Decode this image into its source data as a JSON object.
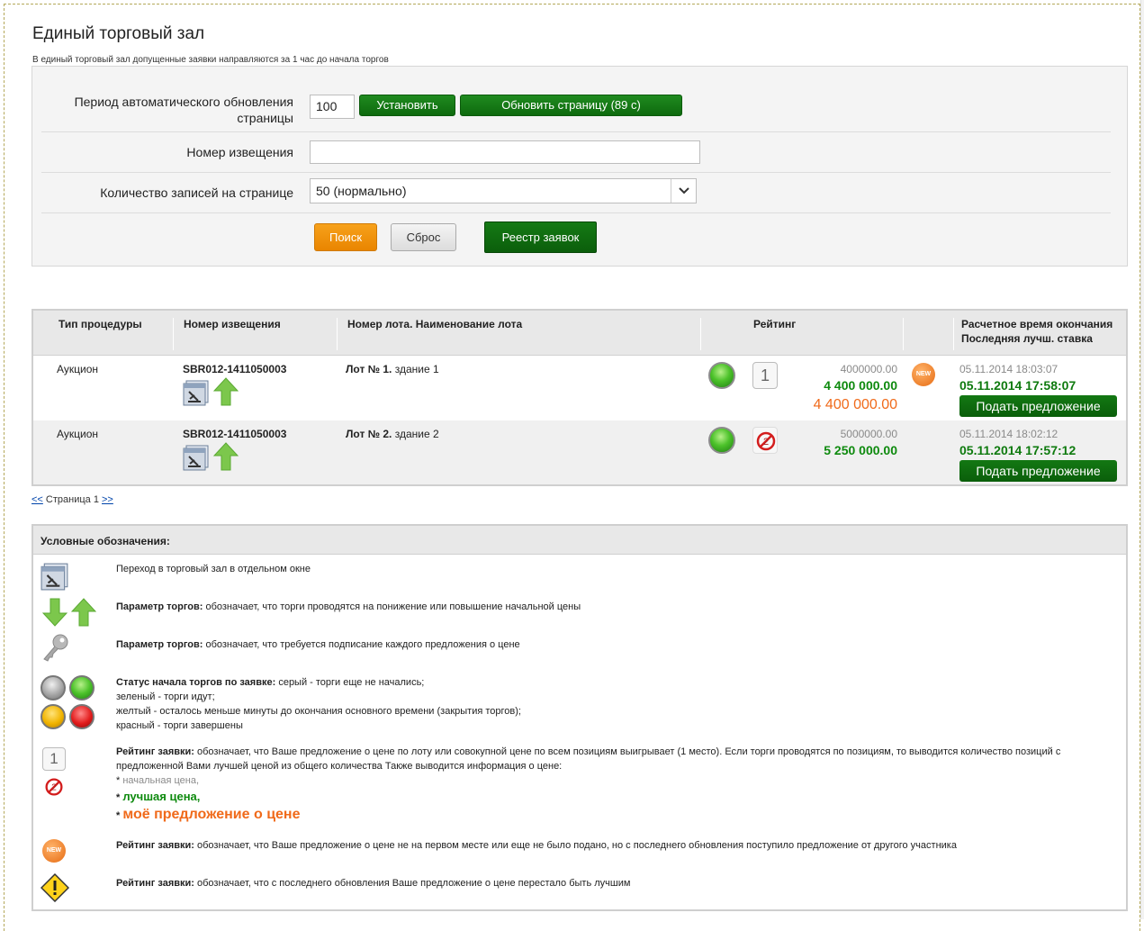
{
  "page": {
    "title": "Единый торговый зал",
    "subtitle": "В единый торговый зал допущенные заявки направляются за 1 час до начала торгов"
  },
  "form": {
    "refresh_label_line1": "Период автоматического обновления",
    "refresh_label_line2": "страницы",
    "refresh_value": "100",
    "set_button": "Установить",
    "refresh_button": "Обновить страницу (89 с)",
    "notice_label": "Номер извещения",
    "notice_value": "",
    "records_label": "Количество записей на странице",
    "records_value": "50 (нормально)",
    "search_button": "Поиск",
    "reset_button": "Сброс",
    "registry_button": "Реестр заявок"
  },
  "table": {
    "headers": {
      "type": "Тип процедуры",
      "notice": "Номер извещения",
      "lot": "Номер лота. Наименование лота",
      "rating": "Рейтинг",
      "end_line1": "Расчетное время окончания",
      "end_line2": "Последняя лучш. ставка"
    },
    "rows": [
      {
        "type": "Аукцион",
        "notice": "SBR012-1411050003",
        "lot_no": "Лот № 1.",
        "lot_name": " здание 1",
        "rank": "1",
        "start_price": "4000000.00",
        "best_price": "4 400 000.00",
        "my_price": "4 400 000.00",
        "badge": "NEW",
        "end_time": "05.11.2014 18:03:07",
        "last_bid_time": "05.11.2014 17:58:07",
        "offer_button": "Подать предложение"
      },
      {
        "type": "Аукцион",
        "notice": "SBR012-1411050003",
        "lot_no": "Лот № 2.",
        "lot_name": " здание 2",
        "start_price": "5000000.00",
        "best_price": "5 250 000.00",
        "end_time": "05.11.2014 18:02:12",
        "last_bid_time": "05.11.2014 17:57:12",
        "offer_button": "Подать предложение"
      }
    ]
  },
  "pager": {
    "prev": "<<",
    "text": " Страница 1 ",
    "next": ">>"
  },
  "legend": {
    "title": "Условные обозначения:",
    "item1": "Переход в торговый зал в отдельном окне",
    "item2_bold": "Параметр торгов:",
    "item2_text": " обозначает, что торги проводятся на понижение или повышение начальной цены",
    "item3_bold": "Параметр торгов:",
    "item3_text": " обозначает, что требуется подписание каждого предложения о цене",
    "item4_bold": "Статус начала торгов по заявке:",
    "item4_text1": " серый - торги еще не начались;",
    "item4_text2": "зеленый - торги идут;",
    "item4_text3": "желтый - осталось меньше минуты до окончания основного времени (закрытия торгов);",
    "item4_text4": "красный - торги завершены",
    "item5_bold": "Рейтинг заявки:",
    "item5_text": " обозначает, что Ваше предложение о цене по лоту или совокупной цене по всем позициям выигрывает (1 место). Если торги проводятся по позициям, то выводится количество позиций с предложенной Вами лучшей ценой из общего количества Также выводится информация о цене:",
    "item5_rank": "1",
    "item5_start": "начальная цена,",
    "item5_best": "лучшая цена,",
    "item5_mine": "моё предложение о цене",
    "new_badge": "NEW",
    "item6_bold": "Рейтинг заявки:",
    "item6_text": " обозначает, что Ваше предложение о цене не на первом месте или еще не было подано, но с последнего обновления поступило предложение от другого участника",
    "item7_bold": "Рейтинг заявки:",
    "item7_text": " обозначает, что с последнего обновления Ваше предложение о цене перестало быть лучшим"
  },
  "colors": {
    "green_button": "#0e6a0e",
    "orange_button": "#f29412",
    "best_price": "#0e8a0e",
    "my_price": "#f06a1a"
  }
}
